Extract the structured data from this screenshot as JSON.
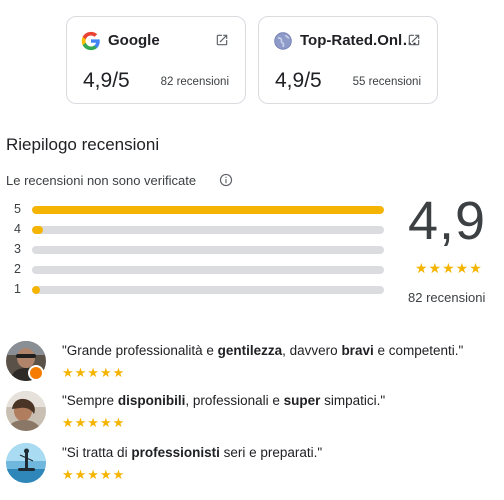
{
  "sources": [
    {
      "name": "Google",
      "score": "4,9/5",
      "count": "82 recensioni",
      "logo_icon": "google-logo-icon",
      "link_icon": "open-in-new-icon"
    },
    {
      "name": "Top-Rated.Onl…",
      "score": "4,9/5",
      "count": "55 recensioni",
      "logo_icon": "globe-icon",
      "link_icon": "open-in-new-icon"
    }
  ],
  "summary": {
    "title": "Riepilogo recensioni",
    "notice": "Le recensioni non sono verificate",
    "info_icon": "info-icon",
    "average": "4,9",
    "stars": "★★★★★",
    "total": "82 recensioni",
    "distribution": [
      {
        "stars": "5",
        "fraction": 1.0
      },
      {
        "stars": "4",
        "fraction": 0.03
      },
      {
        "stars": "3",
        "fraction": 0.0
      },
      {
        "stars": "2",
        "fraction": 0.0
      },
      {
        "stars": "1",
        "fraction": 0.02
      }
    ]
  },
  "reviews": [
    {
      "parts": [
        "\"Grande professionalità e ",
        "gentilezza",
        ", davvero ",
        "bravi",
        " e competenti.\""
      ],
      "bold": [
        false,
        true,
        false,
        true,
        false
      ],
      "stars": "★★★★★",
      "badge": true
    },
    {
      "parts": [
        "\"Sempre ",
        "disponibili",
        ", professionali e ",
        "super",
        " simpatici.\""
      ],
      "bold": [
        false,
        true,
        false,
        true,
        false
      ],
      "stars": "★★★★★",
      "badge": false
    },
    {
      "parts": [
        "\"Si tratta di ",
        "professionisti",
        " seri e preparati.\""
      ],
      "bold": [
        false,
        true,
        false
      ],
      "stars": "★★★★★",
      "badge": false
    }
  ],
  "colors": {
    "star": "#f4b400",
    "bar_bg": "#dadce0",
    "badge": "#f57c00"
  }
}
